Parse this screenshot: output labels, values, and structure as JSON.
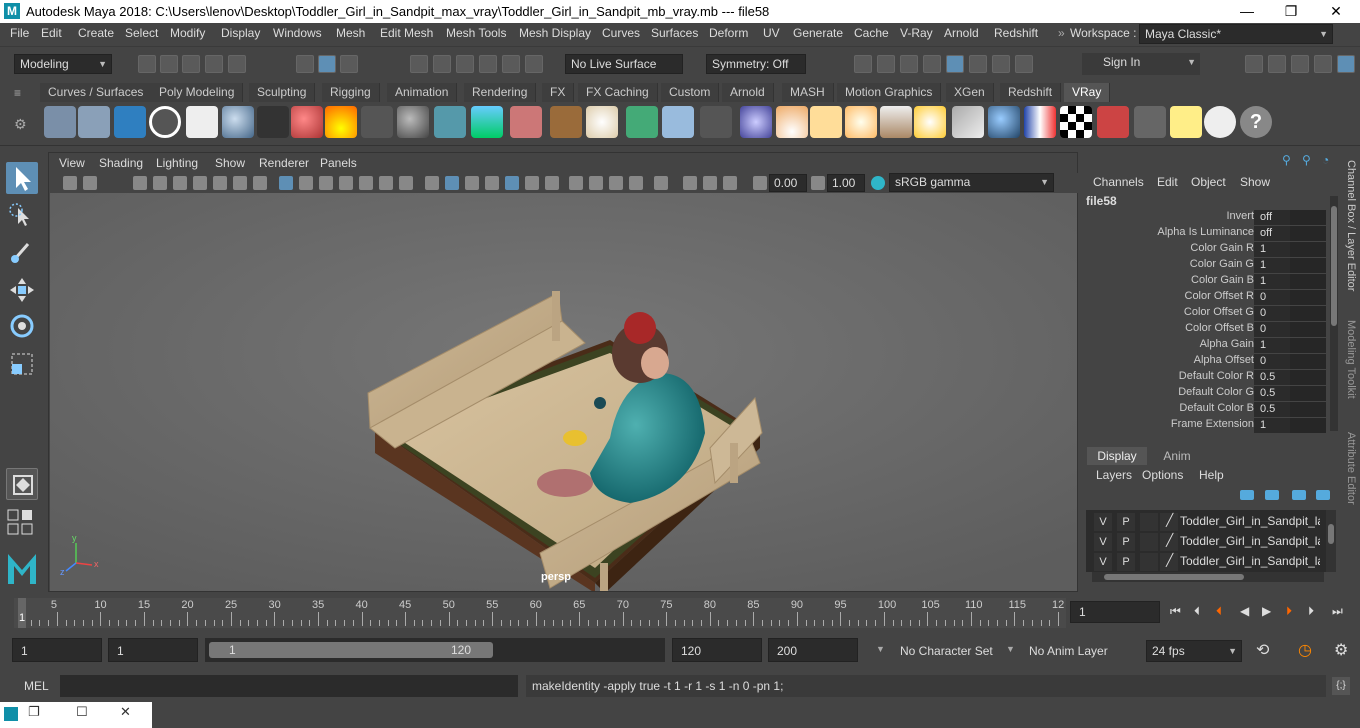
{
  "window": {
    "title": "Autodesk Maya 2018: C:\\Users\\lenov\\Desktop\\Toddler_Girl_in_Sandpit_max_vray\\Toddler_Girl_in_Sandpit_mb_vray.mb   ---   file58",
    "logo": "M",
    "minimize": "—",
    "maximize": "❐",
    "close": "✕"
  },
  "menubar": {
    "items": [
      "File",
      "Edit",
      "Create",
      "Select",
      "Modify",
      "Display",
      "Windows",
      "Mesh",
      "Edit Mesh",
      "Mesh Tools",
      "Mesh Display",
      "Curves",
      "Surfaces",
      "Deform",
      "UV",
      "Generate",
      "Cache",
      "V-Ray",
      "Arnold",
      "Redshift"
    ],
    "workspace_label": "Workspace :",
    "workspace_value": "Maya Classic*"
  },
  "statusline": {
    "mode": "Modeling",
    "live_surface": "No Live Surface",
    "symmetry": "Symmetry: Off",
    "sign_in": "Sign In"
  },
  "shelf": {
    "tabs": [
      "Curves / Surfaces",
      "Poly Modeling",
      "Sculpting",
      "Rigging",
      "Animation",
      "Rendering",
      "FX",
      "FX Caching",
      "Custom",
      "Arnold",
      "MASH",
      "Motion Graphics",
      "XGen",
      "Redshift",
      "VRay"
    ],
    "active": "VRay"
  },
  "viewport": {
    "menu": [
      "View",
      "Shading",
      "Lighting",
      "Show",
      "Renderer",
      "Panels"
    ],
    "exposure": "0.00",
    "gamma": "1.00",
    "color_space": "sRGB gamma",
    "camera_label": "persp",
    "axis_x": "x",
    "axis_y": "y",
    "axis_z": "z"
  },
  "channelbox": {
    "menu": [
      "Channels",
      "Edit",
      "Object",
      "Show"
    ],
    "node": "file58",
    "attributes": [
      {
        "name": "Invert",
        "value": "off"
      },
      {
        "name": "Alpha Is Luminance",
        "value": "off"
      },
      {
        "name": "Color Gain R",
        "value": "1"
      },
      {
        "name": "Color Gain G",
        "value": "1"
      },
      {
        "name": "Color Gain B",
        "value": "1"
      },
      {
        "name": "Color Offset R",
        "value": "0"
      },
      {
        "name": "Color Offset G",
        "value": "0"
      },
      {
        "name": "Color Offset B",
        "value": "0"
      },
      {
        "name": "Alpha Gain",
        "value": "1"
      },
      {
        "name": "Alpha Offset",
        "value": "0"
      },
      {
        "name": "Default Color R",
        "value": "0.5"
      },
      {
        "name": "Default Color G",
        "value": "0.5"
      },
      {
        "name": "Default Color B",
        "value": "0.5"
      },
      {
        "name": "Frame Extension",
        "value": "1"
      }
    ],
    "side_tabs": [
      "Channel Box / Layer Editor",
      "Modeling Toolkit",
      "Attribute Editor"
    ]
  },
  "layers": {
    "tabs": [
      "Display",
      "Anim"
    ],
    "active_tab": "Display",
    "menu": [
      "Layers",
      "Options",
      "Help"
    ],
    "v_label": "V",
    "p_label": "P",
    "rows": [
      {
        "name": "Toddler_Girl_in_Sandpit_layer"
      },
      {
        "name": "Toddler_Girl_in_Sandpit_layer"
      },
      {
        "name": "Toddler_Girl_in_Sandpit_layer"
      }
    ]
  },
  "timeline": {
    "ticks": [
      "5",
      "10",
      "15",
      "20",
      "25",
      "30",
      "35",
      "40",
      "45",
      "50",
      "55",
      "60",
      "65",
      "70",
      "75",
      "80",
      "85",
      "90",
      "95",
      "100",
      "105",
      "110",
      "115",
      "12"
    ],
    "start_marker": "1",
    "current_frame": "1"
  },
  "range": {
    "start": "1",
    "playback_start": "1",
    "slider_start": "1",
    "slider_end": "120",
    "playback_end": "120",
    "end": "200",
    "character_set": "No Character Set",
    "anim_layer": "No Anim Layer",
    "fps": "24 fps"
  },
  "cmdline": {
    "label": "MEL",
    "result": "makeIdentity -apply true -t 1 -r 1 -s 1 -n 0 -pn 1;"
  },
  "colors": {
    "accent": "#5e8fb5",
    "background": "#444444",
    "viewport_bg": "#6b6b6b",
    "field_bg": "#2b2b2b"
  }
}
